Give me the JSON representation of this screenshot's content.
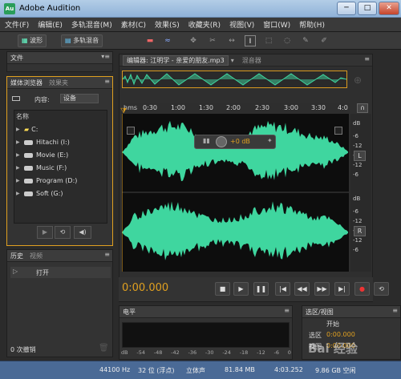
{
  "window": {
    "title": "Adobe Audition",
    "icon_text": "Au"
  },
  "menu": [
    "文件(F)",
    "编辑(E)",
    "多轨混音(M)",
    "素材(C)",
    "效果(S)",
    "收藏夹(R)",
    "视图(V)",
    "窗口(W)",
    "帮助(H)"
  ],
  "toolbar": {
    "waveform_label": "波形",
    "multitrack_label": "多轨混音"
  },
  "files_panel": {
    "title": "文件"
  },
  "media_browser": {
    "tab": "媒体浏览器",
    "tab2": "效果夹",
    "content_label": "内容:",
    "content_value": "设备",
    "column": "名称",
    "drives": [
      "C:",
      "Hitachi (I:)",
      "Movie (E:)",
      "Music (F:)",
      "Program (D:)",
      "Soft (G:)"
    ]
  },
  "history": {
    "tab": "历史",
    "tab2": "视频",
    "item": "打开",
    "undo_count": "0 次撤销"
  },
  "editor": {
    "tab": "编辑器: 江明学 - 亲爱的朋友.mp3",
    "tab2": "混音器",
    "ruler_unit": "hms",
    "ruler_ticks": [
      "0:30",
      "1:00",
      "1:30",
      "2:00",
      "2:30",
      "3:00",
      "3:30",
      "4:0"
    ],
    "hud_value": "+0 dB",
    "db_labels_top": [
      "dB",
      "-6",
      "-12",
      "-∞",
      "-12",
      "-6"
    ],
    "db_labels_bottom": [
      "dB",
      "-6",
      "-12",
      "-∞",
      "-12",
      "-6"
    ],
    "channel_l": "L",
    "channel_r": "R",
    "time": "0:00.000"
  },
  "level_panel": {
    "title": "电平",
    "scale": [
      "dB",
      "-54",
      "-48",
      "-42",
      "-36",
      "-30",
      "-24",
      "-18",
      "-12",
      "-6",
      "0"
    ]
  },
  "selection_panel": {
    "title": "选区/视图",
    "col_start": "开始",
    "row_selection": "选区",
    "sel_start": "0:00.000",
    "row_view": "视图",
    "view_start": "0:00.000"
  },
  "status": {
    "sample_rate": "44100 Hz",
    "bit_depth": "32 位 (浮点)",
    "channels": "立体声",
    "file_size": "81.84 MB",
    "duration": "4:03.252",
    "free": "9.86 GB 空闲"
  },
  "watermark": "Bai 经验",
  "colors": {
    "waveform": "#3fd69f",
    "accent": "#e0a020",
    "time": "#e0a020"
  }
}
